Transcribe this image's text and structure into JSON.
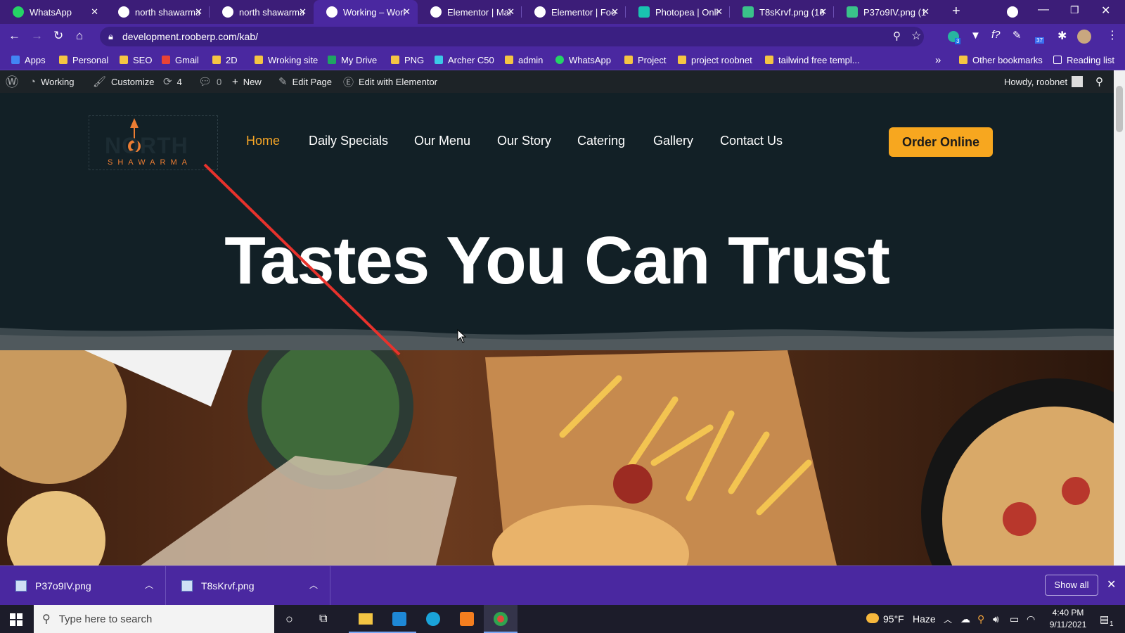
{
  "browser": {
    "tabs": [
      {
        "label": "WhatsApp",
        "fav": "#25d366"
      },
      {
        "label": "north shawarma",
        "fav": "#ffffff"
      },
      {
        "label": "north shawarma",
        "fav": "#ffffff"
      },
      {
        "label": "Working – Worl",
        "fav": "#ffffff",
        "active": true
      },
      {
        "label": "Elementor | Mai",
        "fav": "#ffffff"
      },
      {
        "label": "Elementor | Foo",
        "fav": "#ffffff"
      },
      {
        "label": "Photopea | Onli",
        "fav": "#19c3b0"
      },
      {
        "label": "T8sKrvf.png (16",
        "fav": "#3ac28a"
      },
      {
        "label": "P37o9IV.png (1",
        "fav": "#3ac28a"
      }
    ],
    "url": "development.rooberp.com/kab/",
    "extension_badges": [
      "3",
      "37"
    ],
    "bookmarks": [
      {
        "label": "Apps",
        "kind": "apps-icon"
      },
      {
        "label": "Personal",
        "kind": "folder"
      },
      {
        "label": "SEO",
        "kind": "folder"
      },
      {
        "label": "Gmail",
        "kind": "gmail-icon"
      },
      {
        "label": "2D",
        "kind": "folder"
      },
      {
        "label": "Wroking site",
        "kind": "folder"
      },
      {
        "label": "My Drive",
        "kind": "drive-icon"
      },
      {
        "label": "PNG",
        "kind": "folder"
      },
      {
        "label": "Archer C50",
        "kind": "tplink-icon"
      },
      {
        "label": "admin",
        "kind": "folder"
      },
      {
        "label": "WhatsApp",
        "kind": "whatsapp-icon"
      },
      {
        "label": "Project",
        "kind": "folder"
      },
      {
        "label": "project roobnet",
        "kind": "folder"
      },
      {
        "label": "tailwind free templ...",
        "kind": "folder"
      }
    ],
    "overflow": "»",
    "other_bookmarks": "Other bookmarks",
    "reading_list": "Reading list"
  },
  "wp_admin_bar": {
    "site": "Working",
    "customize": "Customize",
    "updates": "4",
    "comments": "0",
    "new": "New",
    "edit_page": "Edit Page",
    "edit_elementor": "Edit with Elementor",
    "howdy": "Howdy, roobnet"
  },
  "site": {
    "logo_word": "NORTH",
    "logo_sub": "SHAWARMA",
    "nav": [
      "Home",
      "Daily Specials",
      "Our Menu",
      "Our Story",
      "Catering",
      "Gallery",
      "Contact Us"
    ],
    "cta": "Order Online",
    "headline": "Tastes You Can Trust"
  },
  "downloads": {
    "items": [
      "P37o9IV.png",
      "T8sKrvf.png"
    ],
    "show_all": "Show all"
  },
  "taskbar": {
    "search_placeholder": "Type here to search",
    "weather_temp": "95°F",
    "weather_text": "Haze",
    "time": "4:40 PM",
    "date": "9/11/2021",
    "notifications": "1"
  }
}
